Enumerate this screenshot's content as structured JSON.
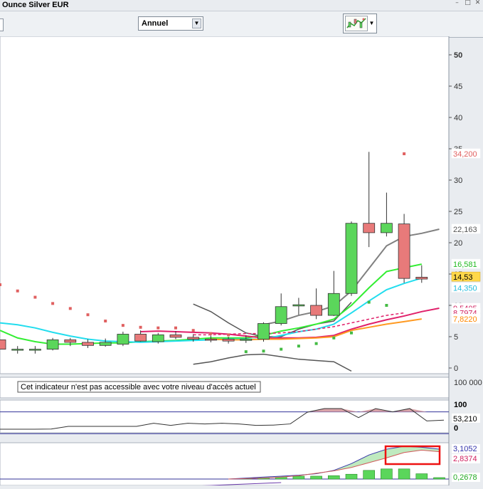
{
  "window": {
    "title": "Ounce Silver EUR"
  },
  "toolbar": {
    "period_value": "Annuel",
    "period_arrow": "▼",
    "chart_type_arrow": "▼"
  },
  "panels": {
    "volume_message": "Cet indicateur n'est pas accessible avec votre niveau d'accès actuel"
  },
  "colors": {
    "up_candle": "#5bd65b",
    "down_candle": "#e87a7a",
    "sar_up": "#44bb44",
    "sar_down": "#e06060",
    "ma_gray": "#808080",
    "ma_green": "#33ee33",
    "ma_cyan": "#22ddee",
    "ma_magenta": "#e0206a",
    "ma_orange": "#ff9a22",
    "bollinger": "#555555",
    "highlight_box": "#ee1111"
  },
  "chart_data": [
    {
      "type": "candlestick",
      "name": "price",
      "y_ticks": [
        "0",
        "5",
        "10",
        "15",
        "20",
        "25",
        "30",
        "35",
        "40",
        "45",
        "50"
      ],
      "ylim": [
        0,
        52
      ],
      "candles": [
        {
          "o": 4.5,
          "h": 4.5,
          "l": 3.0,
          "c": 3.0
        },
        {
          "o": 3.0,
          "h": 3.5,
          "l": 2.3,
          "c": 3.0
        },
        {
          "o": 2.9,
          "h": 3.5,
          "l": 2.3,
          "c": 3.0
        },
        {
          "o": 3.0,
          "h": 4.8,
          "l": 2.8,
          "c": 4.5
        },
        {
          "o": 4.5,
          "h": 4.8,
          "l": 3.5,
          "c": 4.1
        },
        {
          "o": 4.1,
          "h": 4.6,
          "l": 3.2,
          "c": 3.6
        },
        {
          "o": 3.6,
          "h": 4.7,
          "l": 3.4,
          "c": 4.1
        },
        {
          "o": 3.8,
          "h": 5.8,
          "l": 3.5,
          "c": 5.4
        },
        {
          "o": 5.4,
          "h": 6.0,
          "l": 4.2,
          "c": 4.3
        },
        {
          "o": 4.2,
          "h": 5.6,
          "l": 3.9,
          "c": 5.3
        },
        {
          "o": 5.3,
          "h": 5.9,
          "l": 4.6,
          "c": 4.9
        },
        {
          "o": 4.9,
          "h": 5.4,
          "l": 4.2,
          "c": 4.6
        },
        {
          "o": 4.6,
          "h": 5.2,
          "l": 4.1,
          "c": 4.5
        },
        {
          "o": 4.6,
          "h": 5.0,
          "l": 3.9,
          "c": 4.3
        },
        {
          "o": 4.4,
          "h": 5.2,
          "l": 4.0,
          "c": 4.6
        },
        {
          "o": 4.6,
          "h": 7.3,
          "l": 4.2,
          "c": 7.1
        },
        {
          "o": 7.1,
          "h": 11.9,
          "l": 6.8,
          "c": 9.8
        },
        {
          "o": 9.9,
          "h": 11.2,
          "l": 8.5,
          "c": 10.1
        },
        {
          "o": 10.0,
          "h": 12.7,
          "l": 7.8,
          "c": 8.4
        },
        {
          "o": 8.4,
          "h": 15.5,
          "l": 8.3,
          "c": 11.9
        },
        {
          "o": 11.9,
          "h": 23.4,
          "l": 11.5,
          "c": 23.1
        },
        {
          "o": 23.1,
          "h": 34.5,
          "l": 19.3,
          "c": 21.6
        },
        {
          "o": 21.6,
          "h": 28.0,
          "l": 21.0,
          "c": 23.1
        },
        {
          "o": 23.0,
          "h": 24.6,
          "l": 13.6,
          "c": 14.3
        },
        {
          "o": 14.5,
          "h": 16.4,
          "l": 13.6,
          "c": 14.2
        }
      ],
      "sar": [
        {
          "v": 13.3,
          "dir": "down"
        },
        {
          "v": 12.3,
          "dir": "down"
        },
        {
          "v": 11.3,
          "dir": "down"
        },
        {
          "v": 10.3,
          "dir": "down"
        },
        {
          "v": 9.5,
          "dir": "down"
        },
        {
          "v": 8.5,
          "dir": "down"
        },
        {
          "v": 7.5,
          "dir": "down"
        },
        {
          "v": 6.8,
          "dir": "down"
        },
        {
          "v": 6.5,
          "dir": "down"
        },
        {
          "v": 6.4,
          "dir": "down"
        },
        {
          "v": 6.4,
          "dir": "down"
        },
        {
          "v": 6.0,
          "dir": "down"
        },
        {
          "v": 5.5,
          "dir": "down"
        },
        {
          "v": 5.3,
          "dir": "down"
        },
        {
          "v": 2.6,
          "dir": "up"
        },
        {
          "v": 2.7,
          "dir": "up"
        },
        {
          "v": 3.0,
          "dir": "up"
        },
        {
          "v": 3.5,
          "dir": "up"
        },
        {
          "v": 3.9,
          "dir": "up"
        },
        {
          "v": 4.8,
          "dir": "up"
        },
        {
          "v": 5.6,
          "dir": "up"
        },
        {
          "v": 10.5,
          "dir": "up"
        },
        {
          "v": 10.0,
          "dir": "up"
        },
        {
          "v": 34.2,
          "dir": "down"
        }
      ],
      "moving_averages": [
        {
          "color": "ma_gray",
          "start": 15,
          "values": [
            6.9,
            7.5,
            8.4,
            9.0,
            9.9,
            12.3,
            15.9,
            19.5,
            21.0,
            21.5,
            22.163
          ]
        },
        {
          "color": "ma_green",
          "start": 0,
          "values": [
            6.0,
            4.8,
            4.2,
            3.8,
            3.8,
            3.9,
            4.0,
            4.0,
            4.2,
            4.3,
            4.4,
            4.6,
            4.8,
            4.8,
            4.8,
            5.2,
            5.9,
            6.4,
            7.0,
            7.8,
            10.0,
            12.8,
            15.4,
            16.0,
            16.581
          ]
        },
        {
          "color": "ma_cyan",
          "start": 0,
          "values": [
            7.2,
            6.9,
            6.4,
            5.7,
            5.1,
            4.6,
            4.3,
            4.2,
            4.1,
            4.2,
            4.3,
            4.4,
            4.5,
            4.6,
            4.6,
            4.6,
            5.2,
            5.8,
            6.2,
            7.0,
            8.8,
            10.7,
            12.5,
            13.5,
            14.35
          ]
        },
        {
          "color": "ma_magenta",
          "start": 8,
          "values": [
            5.8,
            5.9,
            5.8,
            5.7,
            5.6,
            5.4,
            5.1,
            4.8,
            4.8,
            4.8,
            4.9,
            5.2,
            6.2,
            7.0,
            7.7,
            8.3,
            9.0,
            9.5405
          ]
        },
        {
          "color": "ma_orange",
          "start": 12,
          "values": [
            4.6,
            4.5,
            4.5,
            4.6,
            4.6,
            4.7,
            4.8,
            5.0,
            6.0,
            6.5,
            7.0,
            7.4,
            7.822
          ]
        }
      ],
      "ma_dashed": {
        "color": "ma_magenta",
        "start": 11,
        "values": [
          5.3,
          5.3,
          5.4,
          5.5,
          5.5,
          5.6,
          5.8,
          6.2,
          6.6,
          7.2,
          7.8,
          8.4,
          8.7974
        ]
      },
      "bollinger": {
        "start": 11,
        "upper": [
          10.2,
          9.0,
          7.2,
          5.6,
          5.0,
          5.0,
          6.2,
          7.0,
          7.5,
          10.5
        ],
        "lower": [
          0.6,
          1.0,
          1.6,
          2.1,
          2.2,
          1.8,
          1.4,
          1.2,
          1.0,
          -0.5
        ]
      },
      "right_labels": [
        {
          "text": "34,200",
          "v": 34.2,
          "color": "#e06060",
          "bg": "#ffffff"
        },
        {
          "text": "22,163",
          "v": 22.163,
          "color": "#555555",
          "bg": "#ffffff"
        },
        {
          "text": "16,581",
          "v": 16.581,
          "color": "#22bb22",
          "bg": "#ffffff"
        },
        {
          "text": "14,53",
          "v": 14.53,
          "color": "#000000",
          "bg": "#ffd84a"
        },
        {
          "text": "14,350",
          "v": 12.8,
          "color": "#22bbdd",
          "bg": "#ffffff"
        },
        {
          "text": "9,5405",
          "v": 9.5405,
          "color": "#d02060",
          "bg": "#ffffff"
        },
        {
          "text": "8,7974",
          "v": 8.7974,
          "color": "#d02060",
          "bg": "#ffffff"
        },
        {
          "text": "7,8220",
          "v": 7.822,
          "color": "#ff8800",
          "bg": "#ffffff"
        }
      ]
    },
    {
      "type": "table",
      "name": "volume",
      "y_ticks": [
        "100 000"
      ]
    },
    {
      "type": "line",
      "name": "stochastic",
      "y_ticks": [
        "100",
        "0"
      ],
      "ylim": [
        -25,
        130
      ],
      "upper_band": 80,
      "lower_band": -25,
      "values": [
        -25,
        -25,
        -25,
        -24,
        -8,
        -8,
        -8,
        -8,
        -8,
        11,
        -2,
        11,
        7,
        11,
        7,
        -2,
        0,
        7,
        78,
        100,
        100,
        45,
        100,
        80,
        100,
        25,
        30
      ],
      "last_label": "53,210"
    },
    {
      "type": "area",
      "name": "macd",
      "ylim": [
        0,
        3.4
      ],
      "hist": [
        0,
        0,
        0,
        0,
        0,
        0,
        0,
        0,
        0,
        0,
        0,
        0,
        0,
        0,
        0.05,
        0.15,
        0.25,
        0.3,
        0.3,
        0.35,
        0.5,
        0.9,
        1.05,
        1.05,
        0.55,
        0.15
      ],
      "macd": [
        null,
        null,
        null,
        null,
        null,
        null,
        null,
        null,
        null,
        null,
        null,
        null,
        null,
        0.0,
        0.1,
        0.2,
        0.3,
        0.4,
        0.55,
        0.9,
        1.6,
        2.5,
        3.1,
        3.4,
        3.3,
        3.1052
      ],
      "signal": [
        null,
        null,
        null,
        null,
        null,
        null,
        null,
        null,
        null,
        null,
        null,
        null,
        null,
        0.0,
        0.05,
        0.1,
        0.2,
        0.35,
        0.6,
        0.85,
        1.2,
        1.7,
        2.2,
        2.75,
        3.0,
        2.8374
      ],
      "zero_line": [
        null,
        null,
        null,
        null,
        null,
        null,
        null,
        null,
        null,
        -0.25,
        -0.23,
        -0.2,
        -0.15,
        -0.1,
        -0.05,
        0.0,
        0.05
      ],
      "labels": [
        {
          "text": "3,1052",
          "color": "#3333aa"
        },
        {
          "text": "2,8374",
          "color": "#d02060"
        },
        {
          "text": "0,2678",
          "color": "#22aa22"
        }
      ]
    }
  ]
}
